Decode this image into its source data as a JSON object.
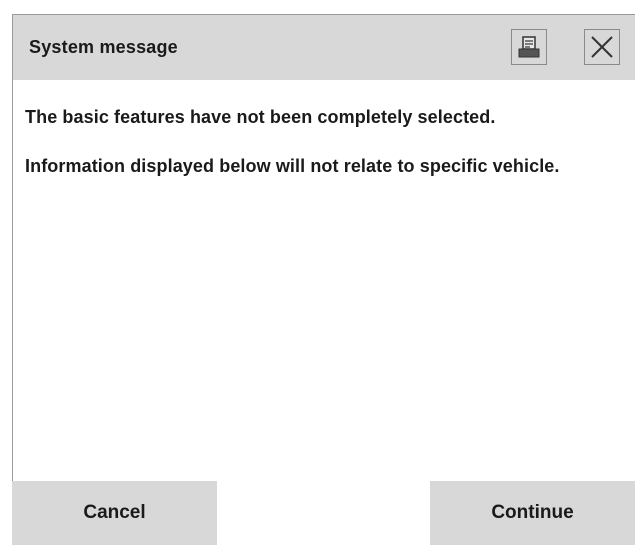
{
  "dialog": {
    "title": "System message",
    "icons": {
      "print": "print-icon",
      "close": "close-icon"
    },
    "messages": [
      "The basic features have not been completely selected.",
      "Information displayed below will not relate to specific vehicle."
    ],
    "buttons": {
      "cancel": "Cancel",
      "continue": "Continue"
    }
  }
}
